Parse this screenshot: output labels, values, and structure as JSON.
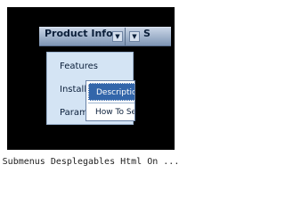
{
  "menubar": {
    "product_info_label": "Product Info",
    "next_item_label": "S"
  },
  "dropdown": {
    "items": [
      {
        "label": "Features"
      },
      {
        "label": "Installa"
      },
      {
        "label": "Paramete"
      }
    ]
  },
  "submenu": {
    "items": [
      {
        "label": "Description"
      },
      {
        "label": "How To Se"
      }
    ]
  },
  "caption": "Submenus Desplegables Html On ..."
}
